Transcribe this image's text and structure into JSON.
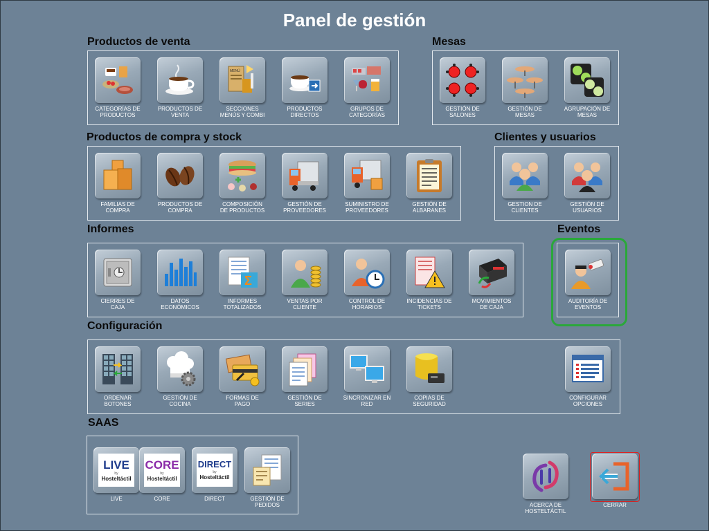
{
  "title": "Panel de gestión",
  "sections": {
    "ventas": "Productos de venta",
    "mesas": "Mesas",
    "compra": "Productos de compra y stock",
    "clientes": "Clientes y usuarios",
    "informes": "Informes",
    "eventos": "Eventos",
    "config": "Configuración",
    "saas": "SAAS"
  },
  "buttons": {
    "cat_productos": {
      "l1": "CATEGORÍAS DE",
      "l2": "PRODUCTOS"
    },
    "prod_venta": {
      "l1": "PRODUCTOS  DE",
      "l2": "VENTA"
    },
    "secciones": {
      "l1": "SECCIONES",
      "l2": "MENÚS Y COMBI"
    },
    "prod_directos": {
      "l1": "PRODUCTOS",
      "l2": "DIRECTOS"
    },
    "grupos_cat": {
      "l1": "GRUPOS DE",
      "l2": "CATEGORÍAS"
    },
    "salones": {
      "l1": "GESTIÓN DE",
      "l2": "SALONES"
    },
    "gest_mesas": {
      "l1": "GESTIÓN DE",
      "l2": "MESAS"
    },
    "agrup_mesas": {
      "l1": "AGRUPACIÓN DE",
      "l2": "MESAS"
    },
    "familias": {
      "l1": "FAMILIAS DE",
      "l2": "COMPRA"
    },
    "prod_compra": {
      "l1": "PRODUCTOS  DE",
      "l2": "COMPRA"
    },
    "composicion": {
      "l1": "COMPOSICIÓN",
      "l2": "DE PRODUCTOS"
    },
    "proveedores": {
      "l1": "GESTIÓN DE",
      "l2": "PROVEEDORES"
    },
    "suministro": {
      "l1": "SUMINISTRO DE",
      "l2": "PROVEEDORES"
    },
    "albaranes": {
      "l1": "GESTIÓN DE",
      "l2": "ALBARANES"
    },
    "clientes": {
      "l1": "GESTION DE",
      "l2": "CLIENTES"
    },
    "usuarios": {
      "l1": "GESTIÓN DE",
      "l2": "USUARIOS"
    },
    "cierres": {
      "l1": "CIERRES DE",
      "l2": "CAJA"
    },
    "datos": {
      "l1": "DATOS",
      "l2": "ECONÓMICOS"
    },
    "inf_totales": {
      "l1": "INFORMES",
      "l2": "TOTALIZADOS"
    },
    "ventas_cliente": {
      "l1": "VENTAS POR",
      "l2": "CLIENTE"
    },
    "horarios": {
      "l1": "CONTROL DE",
      "l2": "HORARIOS"
    },
    "incidencias": {
      "l1": "INCIDENCIAS DE",
      "l2": "TICKETS"
    },
    "movimientos": {
      "l1": "MOVIMIENTOS",
      "l2": "DE CAJA"
    },
    "auditoria": {
      "l1": "AUDITORÍA DE",
      "l2": "EVENTOS"
    },
    "ordenar": {
      "l1": "ORDENAR",
      "l2": "BOTONES"
    },
    "cocina": {
      "l1": "GESTIÓN DE",
      "l2": "COCINA"
    },
    "formas_pago": {
      "l1": "FORMAS DE",
      "l2": "PAGO"
    },
    "series": {
      "l1": "GESTIÓN DE",
      "l2": "SERIES"
    },
    "sincronizar": {
      "l1": "SINCRONIZAR EN",
      "l2": "RED"
    },
    "copias": {
      "l1": "COPIAS DE",
      "l2": "SEGURIDAD"
    },
    "opciones": {
      "l1": "CONFIGURAR",
      "l2": "OPCIONES"
    },
    "live": {
      "l1": "LIVE",
      "l2": ""
    },
    "core": {
      "l1": "CORE",
      "l2": ""
    },
    "direct": {
      "l1": "DIRECT",
      "l2": ""
    },
    "pedidos": {
      "l1": "GESTIÓN DE",
      "l2": "PEDIDOS"
    },
    "acerca": {
      "l1": "ACERCA DE",
      "l2": "HOSTELTÁCTIL"
    },
    "cerrar": {
      "l1": "CERRAR",
      "l2": ""
    }
  },
  "logos": {
    "live": {
      "word": "LIVE",
      "by": "by",
      "brand": "Hosteltáctil"
    },
    "core": {
      "word": "CORE",
      "by": "by",
      "brand": "Hosteltáctil"
    },
    "direct": {
      "word": "DIRECT",
      "by": "by",
      "brand": "Hosteltáctil"
    }
  },
  "colors": {
    "background": "#6d8296",
    "highlight": "#2aa83a",
    "close_border": "#dd2222",
    "close_arrow": "#e8632b"
  }
}
